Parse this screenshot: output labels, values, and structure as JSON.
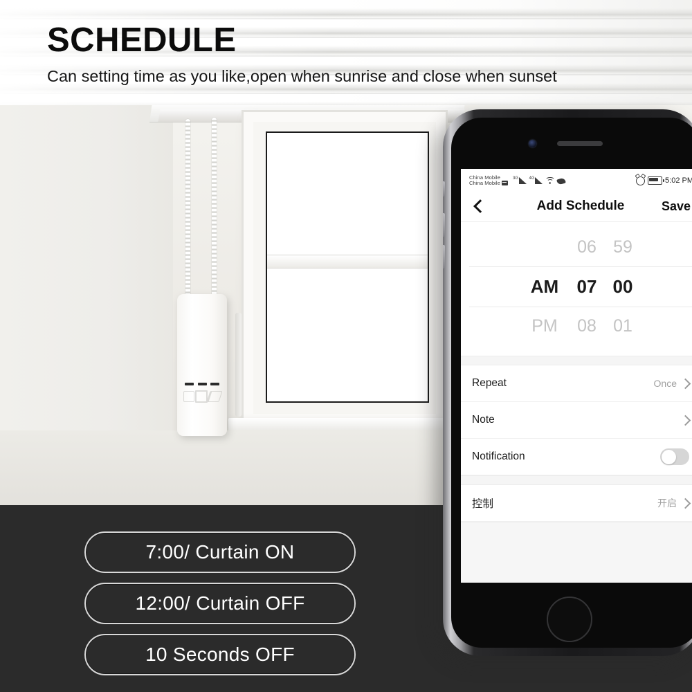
{
  "header": {
    "title": "SCHEDULE",
    "subtitle": "Can setting time as you like,open when sunrise and close when sunset"
  },
  "photo": {
    "device_name": "curtain-motor-device",
    "colors": {
      "wall": "#eeedea",
      "dark_band": "#2b2b2b"
    }
  },
  "feature_pills": [
    {
      "label": "7:00/ Curtain ON"
    },
    {
      "label": "12:00/ Curtain OFF"
    },
    {
      "label": "10 Seconds OFF"
    }
  ],
  "phone": {
    "status_bar": {
      "carrier_line1": "China Mobile",
      "carrier_line2": "China Mobile",
      "icons": [
        "sim-badge-icon",
        "signal-3g-icon",
        "signal-4g-icon",
        "wifi-icon",
        "vibrate-icon",
        "alarm-clock-icon",
        "battery-icon"
      ],
      "signal_label_1": "3G",
      "signal_label_2": "4G",
      "time": "5:02 PM"
    },
    "nav": {
      "back_icon": "chevron-left-icon",
      "title": "Add Schedule",
      "save_label": "Save"
    },
    "time_picker": {
      "rows": [
        {
          "ampm": "",
          "hour": "06",
          "minute": "59",
          "selected": false
        },
        {
          "ampm": "AM",
          "hour": "07",
          "minute": "00",
          "selected": true
        },
        {
          "ampm": "PM",
          "hour": "08",
          "minute": "01",
          "selected": false
        }
      ]
    },
    "settings_rows": [
      {
        "label": "Repeat",
        "value": "Once",
        "type": "chevron"
      },
      {
        "label": "Note",
        "value": "",
        "type": "chevron"
      },
      {
        "label": "Notification",
        "value": "",
        "type": "toggle",
        "toggle_on": false
      },
      {
        "label": "控制",
        "value": "开启",
        "type": "chevron"
      }
    ]
  }
}
